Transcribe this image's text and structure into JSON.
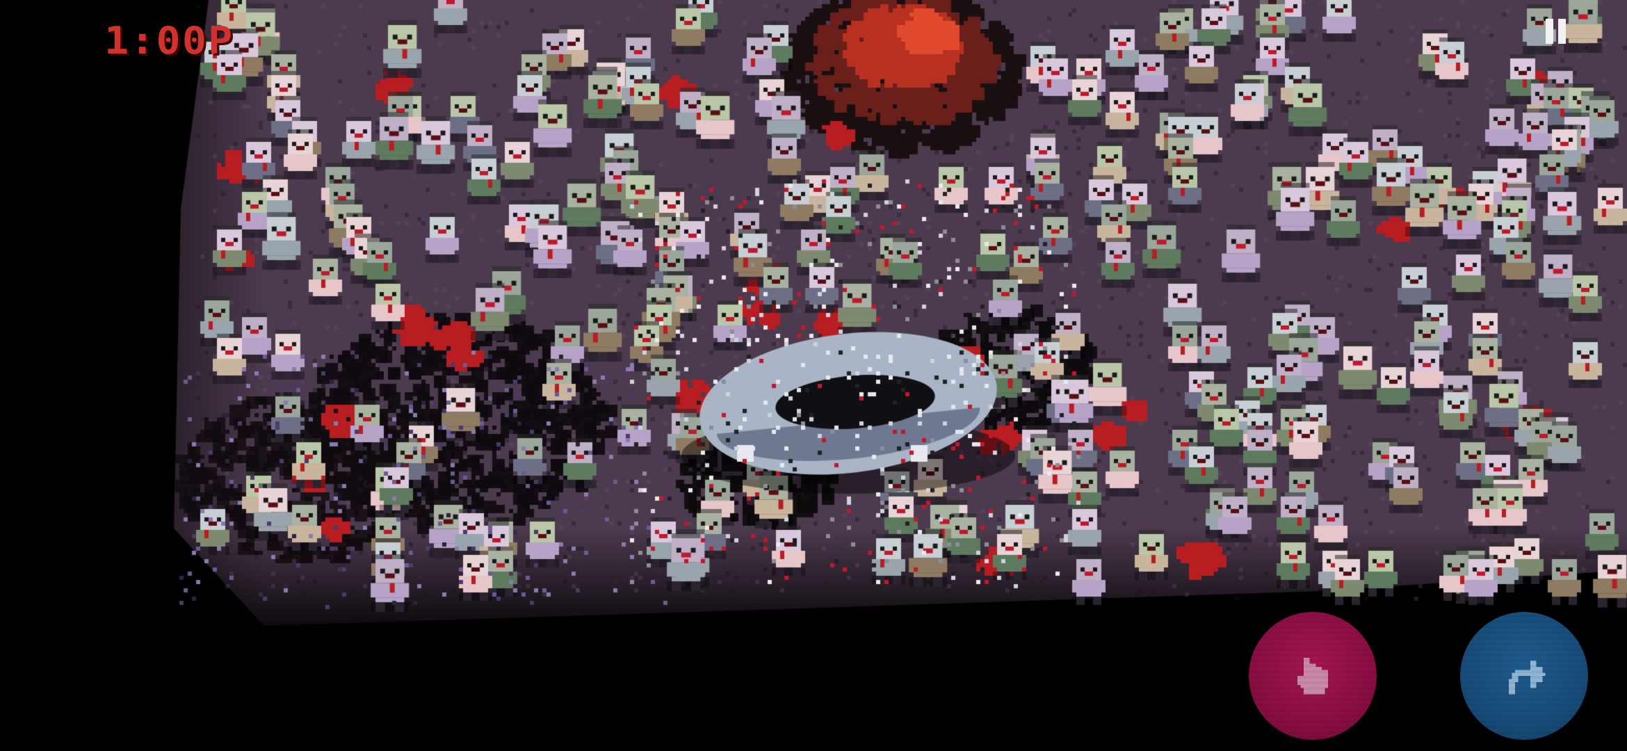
{
  "hud": {
    "timer_text": "1:00P"
  },
  "controls": {
    "pause": {
      "icon": "pause-icon"
    },
    "grab": {
      "icon": "hand-icon",
      "color": "#8a0e42"
    },
    "jump": {
      "icon": "curved-arrow-icon",
      "color": "#174d7a"
    }
  },
  "scene": {
    "ground_color": "#4c3a4e",
    "void_color": "#000000",
    "blood_color": "#b81d22",
    "vehicle_color": "#a9b4c6",
    "zombie_palette": [
      "#7d8a6f",
      "#9aa4ad",
      "#b7a3c7",
      "#e7c6c9",
      "#6c6f86",
      "#8f7a62",
      "#5e7b5f",
      "#c9b59d"
    ]
  }
}
